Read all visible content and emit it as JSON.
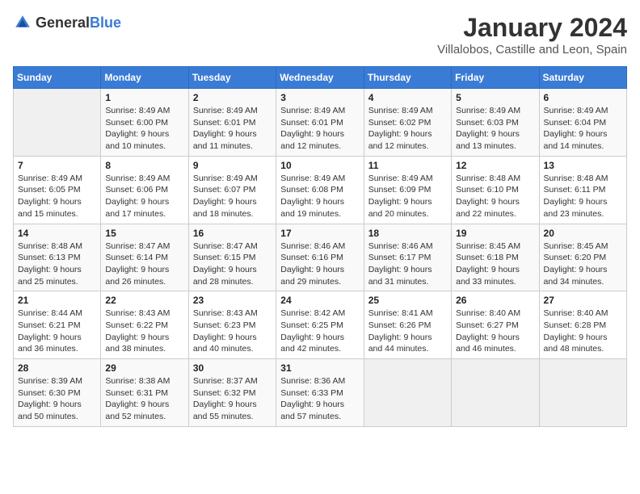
{
  "header": {
    "logo_general": "General",
    "logo_blue": "Blue",
    "month_title": "January 2024",
    "location": "Villalobos, Castille and Leon, Spain"
  },
  "weekdays": [
    "Sunday",
    "Monday",
    "Tuesday",
    "Wednesday",
    "Thursday",
    "Friday",
    "Saturday"
  ],
  "weeks": [
    [
      {
        "day": "",
        "sunrise": "",
        "sunset": "",
        "daylight": ""
      },
      {
        "day": "1",
        "sunrise": "Sunrise: 8:49 AM",
        "sunset": "Sunset: 6:00 PM",
        "daylight": "Daylight: 9 hours and 10 minutes."
      },
      {
        "day": "2",
        "sunrise": "Sunrise: 8:49 AM",
        "sunset": "Sunset: 6:01 PM",
        "daylight": "Daylight: 9 hours and 11 minutes."
      },
      {
        "day": "3",
        "sunrise": "Sunrise: 8:49 AM",
        "sunset": "Sunset: 6:01 PM",
        "daylight": "Daylight: 9 hours and 12 minutes."
      },
      {
        "day": "4",
        "sunrise": "Sunrise: 8:49 AM",
        "sunset": "Sunset: 6:02 PM",
        "daylight": "Daylight: 9 hours and 12 minutes."
      },
      {
        "day": "5",
        "sunrise": "Sunrise: 8:49 AM",
        "sunset": "Sunset: 6:03 PM",
        "daylight": "Daylight: 9 hours and 13 minutes."
      },
      {
        "day": "6",
        "sunrise": "Sunrise: 8:49 AM",
        "sunset": "Sunset: 6:04 PM",
        "daylight": "Daylight: 9 hours and 14 minutes."
      }
    ],
    [
      {
        "day": "7",
        "sunrise": "Sunrise: 8:49 AM",
        "sunset": "Sunset: 6:05 PM",
        "daylight": "Daylight: 9 hours and 15 minutes."
      },
      {
        "day": "8",
        "sunrise": "Sunrise: 8:49 AM",
        "sunset": "Sunset: 6:06 PM",
        "daylight": "Daylight: 9 hours and 17 minutes."
      },
      {
        "day": "9",
        "sunrise": "Sunrise: 8:49 AM",
        "sunset": "Sunset: 6:07 PM",
        "daylight": "Daylight: 9 hours and 18 minutes."
      },
      {
        "day": "10",
        "sunrise": "Sunrise: 8:49 AM",
        "sunset": "Sunset: 6:08 PM",
        "daylight": "Daylight: 9 hours and 19 minutes."
      },
      {
        "day": "11",
        "sunrise": "Sunrise: 8:49 AM",
        "sunset": "Sunset: 6:09 PM",
        "daylight": "Daylight: 9 hours and 20 minutes."
      },
      {
        "day": "12",
        "sunrise": "Sunrise: 8:48 AM",
        "sunset": "Sunset: 6:10 PM",
        "daylight": "Daylight: 9 hours and 22 minutes."
      },
      {
        "day": "13",
        "sunrise": "Sunrise: 8:48 AM",
        "sunset": "Sunset: 6:11 PM",
        "daylight": "Daylight: 9 hours and 23 minutes."
      }
    ],
    [
      {
        "day": "14",
        "sunrise": "Sunrise: 8:48 AM",
        "sunset": "Sunset: 6:13 PM",
        "daylight": "Daylight: 9 hours and 25 minutes."
      },
      {
        "day": "15",
        "sunrise": "Sunrise: 8:47 AM",
        "sunset": "Sunset: 6:14 PM",
        "daylight": "Daylight: 9 hours and 26 minutes."
      },
      {
        "day": "16",
        "sunrise": "Sunrise: 8:47 AM",
        "sunset": "Sunset: 6:15 PM",
        "daylight": "Daylight: 9 hours and 28 minutes."
      },
      {
        "day": "17",
        "sunrise": "Sunrise: 8:46 AM",
        "sunset": "Sunset: 6:16 PM",
        "daylight": "Daylight: 9 hours and 29 minutes."
      },
      {
        "day": "18",
        "sunrise": "Sunrise: 8:46 AM",
        "sunset": "Sunset: 6:17 PM",
        "daylight": "Daylight: 9 hours and 31 minutes."
      },
      {
        "day": "19",
        "sunrise": "Sunrise: 8:45 AM",
        "sunset": "Sunset: 6:18 PM",
        "daylight": "Daylight: 9 hours and 33 minutes."
      },
      {
        "day": "20",
        "sunrise": "Sunrise: 8:45 AM",
        "sunset": "Sunset: 6:20 PM",
        "daylight": "Daylight: 9 hours and 34 minutes."
      }
    ],
    [
      {
        "day": "21",
        "sunrise": "Sunrise: 8:44 AM",
        "sunset": "Sunset: 6:21 PM",
        "daylight": "Daylight: 9 hours and 36 minutes."
      },
      {
        "day": "22",
        "sunrise": "Sunrise: 8:43 AM",
        "sunset": "Sunset: 6:22 PM",
        "daylight": "Daylight: 9 hours and 38 minutes."
      },
      {
        "day": "23",
        "sunrise": "Sunrise: 8:43 AM",
        "sunset": "Sunset: 6:23 PM",
        "daylight": "Daylight: 9 hours and 40 minutes."
      },
      {
        "day": "24",
        "sunrise": "Sunrise: 8:42 AM",
        "sunset": "Sunset: 6:25 PM",
        "daylight": "Daylight: 9 hours and 42 minutes."
      },
      {
        "day": "25",
        "sunrise": "Sunrise: 8:41 AM",
        "sunset": "Sunset: 6:26 PM",
        "daylight": "Daylight: 9 hours and 44 minutes."
      },
      {
        "day": "26",
        "sunrise": "Sunrise: 8:40 AM",
        "sunset": "Sunset: 6:27 PM",
        "daylight": "Daylight: 9 hours and 46 minutes."
      },
      {
        "day": "27",
        "sunrise": "Sunrise: 8:40 AM",
        "sunset": "Sunset: 6:28 PM",
        "daylight": "Daylight: 9 hours and 48 minutes."
      }
    ],
    [
      {
        "day": "28",
        "sunrise": "Sunrise: 8:39 AM",
        "sunset": "Sunset: 6:30 PM",
        "daylight": "Daylight: 9 hours and 50 minutes."
      },
      {
        "day": "29",
        "sunrise": "Sunrise: 8:38 AM",
        "sunset": "Sunset: 6:31 PM",
        "daylight": "Daylight: 9 hours and 52 minutes."
      },
      {
        "day": "30",
        "sunrise": "Sunrise: 8:37 AM",
        "sunset": "Sunset: 6:32 PM",
        "daylight": "Daylight: 9 hours and 55 minutes."
      },
      {
        "day": "31",
        "sunrise": "Sunrise: 8:36 AM",
        "sunset": "Sunset: 6:33 PM",
        "daylight": "Daylight: 9 hours and 57 minutes."
      },
      {
        "day": "",
        "sunrise": "",
        "sunset": "",
        "daylight": ""
      },
      {
        "day": "",
        "sunrise": "",
        "sunset": "",
        "daylight": ""
      },
      {
        "day": "",
        "sunrise": "",
        "sunset": "",
        "daylight": ""
      }
    ]
  ]
}
